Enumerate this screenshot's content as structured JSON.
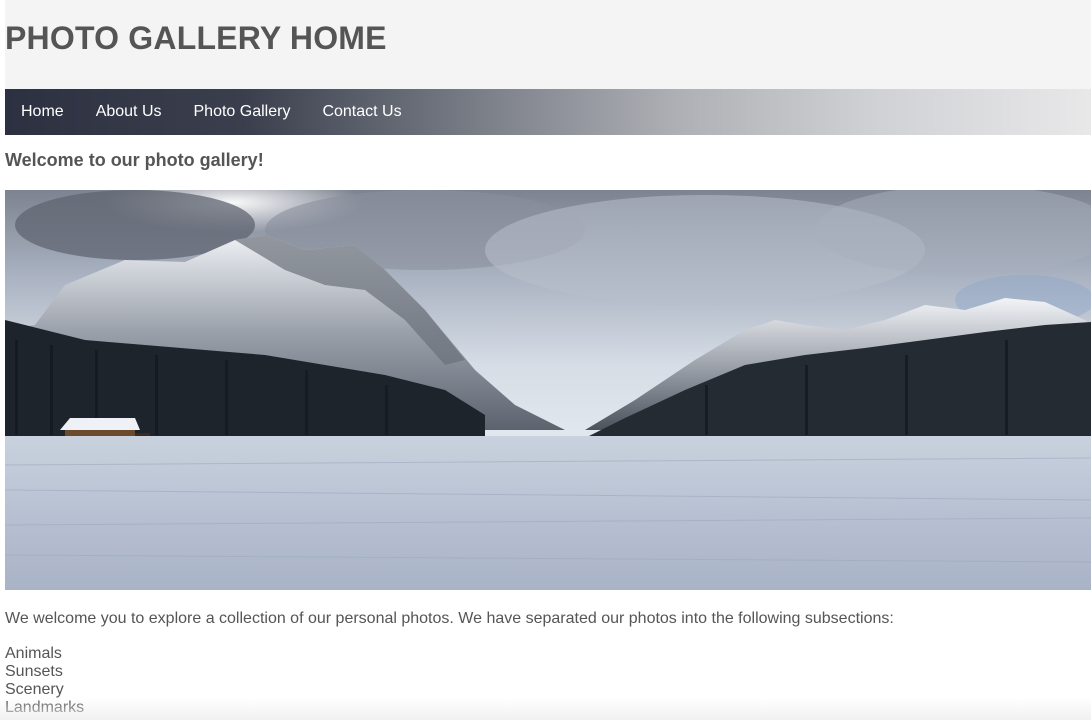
{
  "header": {
    "title": "PHOTO GALLERY HOME"
  },
  "nav": {
    "items": [
      {
        "label": "Home"
      },
      {
        "label": "About Us"
      },
      {
        "label": "Photo Gallery"
      },
      {
        "label": "Contact Us"
      }
    ]
  },
  "main": {
    "welcome": "Welcome to our photo gallery!",
    "intro": "We welcome you to explore a collection of our personal photos. We have separated our photos into the following subsections:",
    "subsections": [
      {
        "label": "Animals"
      },
      {
        "label": "Sunsets"
      },
      {
        "label": "Scenery"
      },
      {
        "label": "Landmarks"
      }
    ]
  },
  "colors": {
    "header_bg": "#f4f4f4",
    "title_text": "#555555",
    "nav_gradient_start": "#2c3040",
    "nav_gradient_end": "#e8e8e9",
    "nav_text": "#ffffff"
  }
}
